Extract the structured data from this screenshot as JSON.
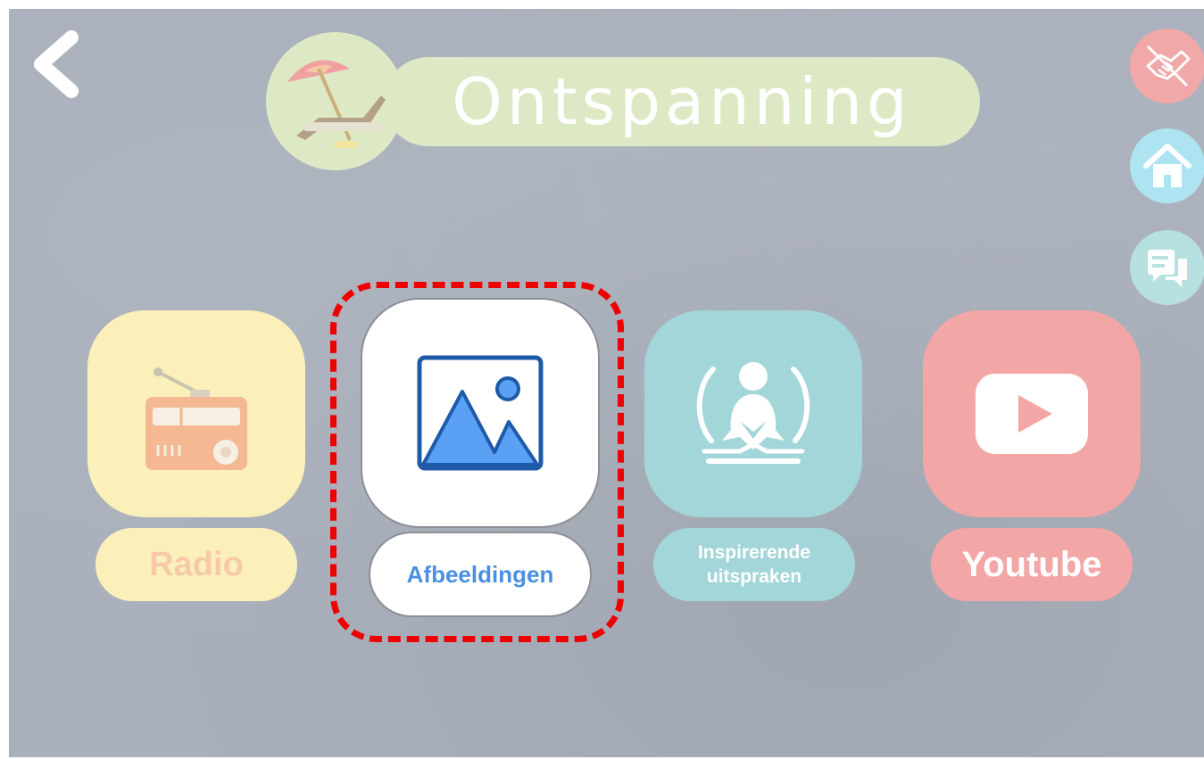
{
  "header": {
    "title": "Ontspanning",
    "title_icon": "beach-chair-umbrella-icon",
    "back_icon": "chevron-left-icon"
  },
  "side_buttons": [
    {
      "icon": "handshake-off-icon",
      "color": "#f0a8a8"
    },
    {
      "icon": "home-icon",
      "color": "#aee3f2"
    },
    {
      "icon": "chat-bubbles-icon",
      "color": "#b7e0e0"
    }
  ],
  "tiles": [
    {
      "label": "Radio",
      "icon": "radio-icon",
      "color": "#fbf0b9"
    },
    {
      "label": "Afbeeldingen",
      "icon": "image-icon",
      "color": "#ffffff",
      "selected": true
    },
    {
      "label_line1": "Inspirerende",
      "label_line2": "uitspraken",
      "icon": "meditation-icon",
      "color": "#a3d6d8"
    },
    {
      "label": "Youtube",
      "icon": "youtube-play-icon",
      "color": "#f3a6a6"
    }
  ],
  "colors": {
    "background": "#a9b0bb",
    "highlight": "#ee0000",
    "accent_blue": "#4a90e2"
  }
}
